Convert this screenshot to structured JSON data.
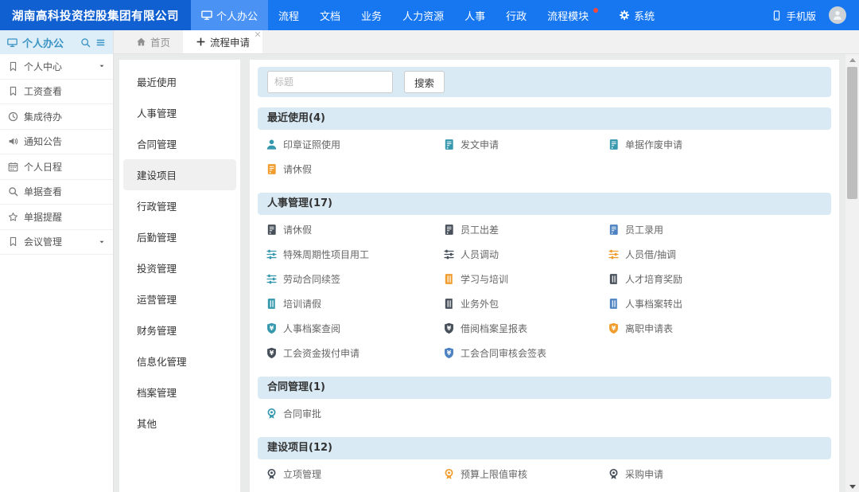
{
  "colors": {
    "topbar": "#1777f0",
    "topbar_dark": "#1160d2",
    "topbar_active": "#4b92f5",
    "section_bar": "#d9eaf5",
    "teal": "#3598ad",
    "orange": "#f09d2e",
    "dark": "#47505a",
    "blue": "#4d82c2"
  },
  "topbar": {
    "company": "湖南高科投资控股集团有限公司",
    "nav": [
      {
        "label": "个人办公",
        "icon": "monitor",
        "active": true
      },
      {
        "label": "流程"
      },
      {
        "label": "文档"
      },
      {
        "label": "业务"
      },
      {
        "label": "人力资源"
      },
      {
        "label": "人事"
      },
      {
        "label": "行政"
      },
      {
        "label": "流程模块",
        "badge": "dot"
      },
      {
        "label": "系统",
        "icon": "gear"
      }
    ],
    "right": {
      "mobile_label": "手机版"
    }
  },
  "sidebar": {
    "title": "个人办公",
    "items": [
      {
        "label": "个人中心",
        "icon": "bookmark",
        "expandable": true
      },
      {
        "label": "工资查看",
        "icon": "bookmark"
      },
      {
        "label": "集成待办",
        "icon": "clock"
      },
      {
        "label": "通知公告",
        "icon": "speaker"
      },
      {
        "label": "个人日程",
        "icon": "calendar"
      },
      {
        "label": "单据查看",
        "icon": "search"
      },
      {
        "label": "单据提醒",
        "icon": "star"
      },
      {
        "label": "会议管理",
        "icon": "bookmark",
        "expandable": true
      }
    ]
  },
  "tabs": [
    {
      "label": "首页",
      "icon": "home",
      "active": false
    },
    {
      "label": "流程申请",
      "icon": "plus",
      "active": true,
      "closable": true
    }
  ],
  "categories": {
    "selected": "建设项目",
    "items": [
      "最近使用",
      "人事管理",
      "合同管理",
      "建设项目",
      "行政管理",
      "后勤管理",
      "投资管理",
      "运营管理",
      "财务管理",
      "信息化管理",
      "档案管理",
      "其他"
    ]
  },
  "search": {
    "placeholder": "标题",
    "button": "搜索"
  },
  "sections": [
    {
      "title": "最近使用(4)",
      "items": [
        {
          "label": "印章证照使用",
          "icon": "person",
          "color": "teal"
        },
        {
          "label": "发文申请",
          "icon": "doc",
          "color": "teal"
        },
        {
          "label": "单据作废申请",
          "icon": "doc",
          "color": "teal"
        },
        {
          "label": "请休假",
          "icon": "doc",
          "color": "orange"
        }
      ]
    },
    {
      "title": "人事管理(17)",
      "items": [
        {
          "label": "请休假",
          "icon": "doc",
          "color": "dark"
        },
        {
          "label": "员工出差",
          "icon": "doc",
          "color": "dark"
        },
        {
          "label": "员工录用",
          "icon": "doc",
          "color": "blue"
        },
        {
          "label": "特殊周期性项目用工",
          "icon": "sliders",
          "color": "teal"
        },
        {
          "label": "人员调动",
          "icon": "sliders",
          "color": "dark"
        },
        {
          "label": "人员借/抽调",
          "icon": "sliders",
          "color": "orange"
        },
        {
          "label": "劳动合同续签",
          "icon": "sliders",
          "color": "teal"
        },
        {
          "label": "学习与培训",
          "icon": "book",
          "color": "orange"
        },
        {
          "label": "人才培育奖励",
          "icon": "book",
          "color": "dark"
        },
        {
          "label": "培训请假",
          "icon": "book",
          "color": "teal"
        },
        {
          "label": "业务外包",
          "icon": "book",
          "color": "dark"
        },
        {
          "label": "人事档案转出",
          "icon": "book",
          "color": "blue"
        },
        {
          "label": "人事档案查阅",
          "icon": "money",
          "color": "teal"
        },
        {
          "label": "借阅档案呈报表",
          "icon": "money",
          "color": "dark"
        },
        {
          "label": "离职申请表",
          "icon": "money",
          "color": "orange"
        },
        {
          "label": "工会资金拨付申请",
          "icon": "money",
          "color": "dark"
        },
        {
          "label": "工会合同审核会签表",
          "icon": "money",
          "color": "blue"
        }
      ]
    },
    {
      "title": "合同管理(1)",
      "items": [
        {
          "label": "合同审批",
          "icon": "badge",
          "color": "teal"
        }
      ]
    },
    {
      "title": "建设项目(12)",
      "items": [
        {
          "label": "立项管理",
          "icon": "badge",
          "color": "dark"
        },
        {
          "label": "预算上限值审核",
          "icon": "badge",
          "color": "orange"
        },
        {
          "label": "采购申请",
          "icon": "badge",
          "color": "dark"
        }
      ]
    }
  ]
}
